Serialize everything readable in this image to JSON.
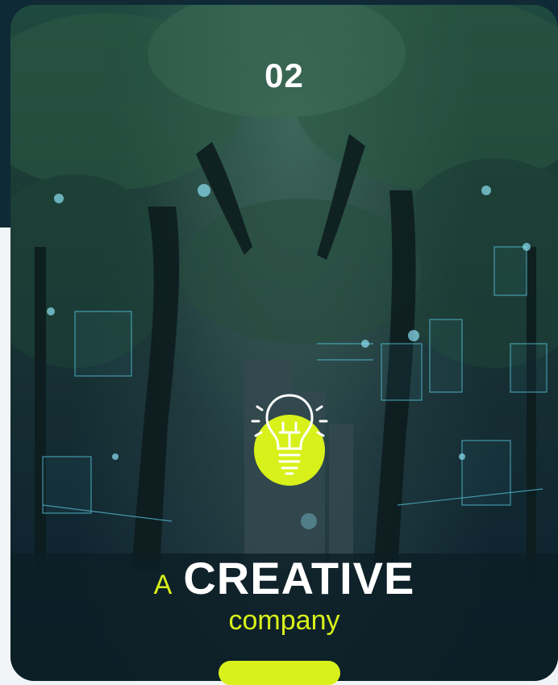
{
  "slide": {
    "number": "02",
    "headline_prefix": "A",
    "headline_main": "CREATIVE",
    "subtitle": "company"
  },
  "icons": {
    "center": "lightbulb-icon"
  },
  "colors": {
    "accent": "#d8f11a",
    "dark": "#0f2a36",
    "text": "#ffffff"
  }
}
